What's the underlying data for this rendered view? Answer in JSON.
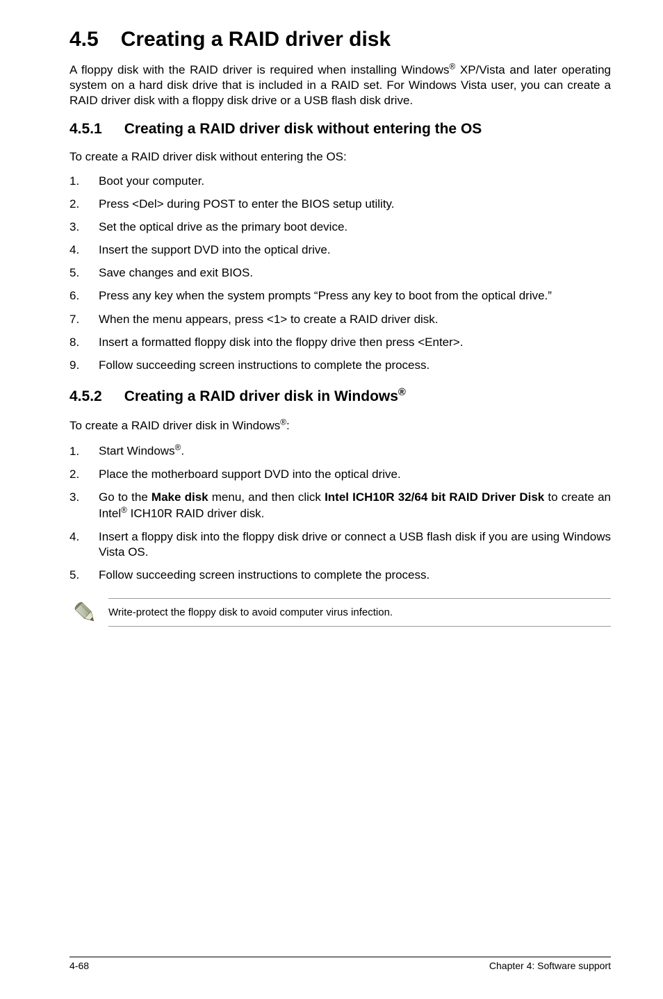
{
  "heading": {
    "number": "4.5",
    "title": "Creating a RAID driver disk"
  },
  "intro": "A floppy disk with the RAID driver is required when installing Windows® XP/Vista and later operating system on a hard disk drive that is included in a RAID set. For Windows Vista user, you can create a RAID driver disk with a floppy disk drive or a USB flash disk drive.",
  "section1": {
    "number": "4.5.1",
    "title": "Creating a RAID driver disk without entering the OS",
    "lead": "To create a RAID driver disk without entering the OS:",
    "steps": [
      "Boot your computer.",
      "Press <Del> during POST to enter the BIOS setup utility.",
      "Set the optical drive as the primary boot device.",
      "Insert the support DVD into the optical drive.",
      "Save changes and exit BIOS.",
      "Press any key when the system prompts “Press any key to boot from the optical drive.”",
      "When the menu appears, press <1> to create a RAID driver disk.",
      "Insert a formatted floppy disk into the floppy drive then press <Enter>.",
      "Follow succeeding screen instructions to complete the process."
    ]
  },
  "section2": {
    "number": "4.5.2",
    "title_prefix": "Creating a RAID driver disk in Windows",
    "lead": "To create a RAID driver disk in Windows®:",
    "steps_html": [
      "Start Windows<sup>®</sup>.",
      "Place the motherboard support DVD into the optical drive.",
      "Go to the <b>Make disk</b> menu, and then click <b>Intel ICH10R 32/64 bit RAID Driver Disk</b> to create an Intel<sup>®</sup> ICH10R RAID driver disk.",
      "Insert a floppy disk into the floppy disk drive or connect a USB flash disk if you are using Windows Vista OS.",
      "Follow succeeding screen instructions to complete the process."
    ]
  },
  "note": "Write-protect the floppy disk to avoid computer virus infection.",
  "footer": {
    "left": "4-68",
    "right": "Chapter 4: Software support"
  }
}
